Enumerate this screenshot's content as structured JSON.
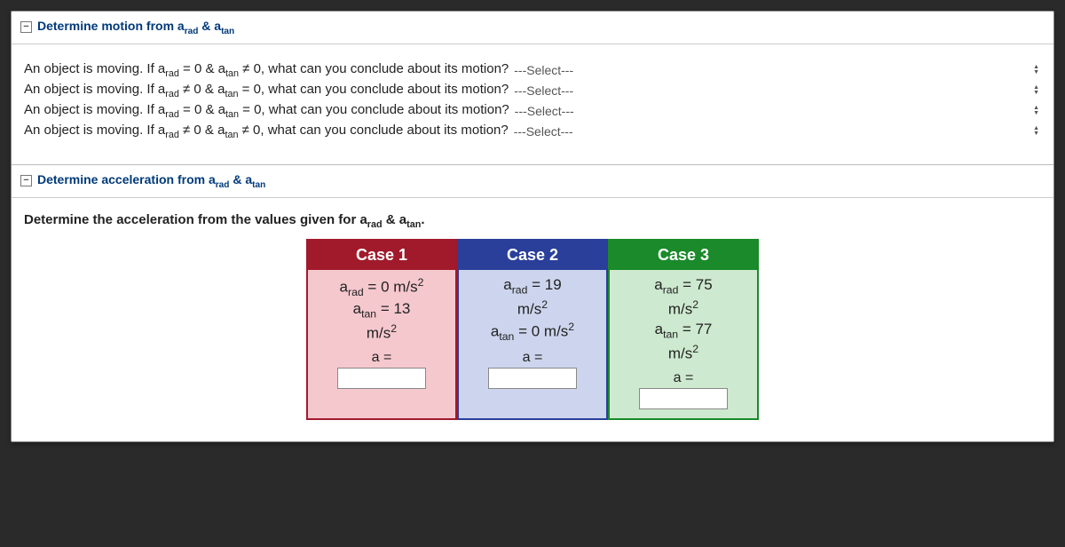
{
  "section1": {
    "title_pre": "Determine motion from a",
    "title_sub1": "rad",
    "title_mid": " & a",
    "title_sub2": "tan",
    "questions": [
      {
        "pre": "An object is moving. If a",
        "sub1": "rad",
        "mid1": " = 0 & a",
        "sub2": "tan",
        "mid2": " ≠ 0, what can you conclude about its motion?",
        "select": "---Select---"
      },
      {
        "pre": "An object is moving. If a",
        "sub1": "rad",
        "mid1": " ≠ 0 & a",
        "sub2": "tan",
        "mid2": " = 0, what can you conclude about its motion?",
        "select": "---Select---"
      },
      {
        "pre": "An object is moving. If a",
        "sub1": "rad",
        "mid1": " = 0 & a",
        "sub2": "tan",
        "mid2": " = 0, what can you conclude about its motion?",
        "select": "---Select---"
      },
      {
        "pre": "An object is moving. If a",
        "sub1": "rad",
        "mid1": " ≠ 0 & a",
        "sub2": "tan",
        "mid2": " ≠ 0, what can you conclude about its motion?",
        "select": "---Select---"
      }
    ]
  },
  "section2": {
    "title_pre": "Determine acceleration from a",
    "title_sub1": "rad",
    "title_mid": " & a",
    "title_sub2": "tan",
    "prompt_pre": "Determine the acceleration from the values given for a",
    "prompt_sub1": "rad",
    "prompt_mid": " & a",
    "prompt_sub2": "tan",
    "prompt_end": ".",
    "cases": [
      {
        "title": "Case 1",
        "arad_label": "a",
        "arad_sub": "rad",
        "arad_eq": " = 0 m/s",
        "atan_label": "a",
        "atan_sub": "tan",
        "atan_eq": " = 13",
        "unit_line": "m/s",
        "a_label": "a ="
      },
      {
        "title": "Case 2",
        "arad_label": "a",
        "arad_sub": "rad",
        "arad_eq": " = 19",
        "arad_unit": "m/s",
        "atan_label": "a",
        "atan_sub": "tan",
        "atan_eq": " = 0 m/s",
        "a_label": "a ="
      },
      {
        "title": "Case 3",
        "arad_label": "a",
        "arad_sub": "rad",
        "arad_eq": " = 75",
        "arad_unit": "m/s",
        "atan_label": "a",
        "atan_sub": "tan",
        "atan_eq": " = 77",
        "atan_unit": "m/s",
        "a_label": "a ="
      }
    ]
  },
  "collapse_glyph": "−"
}
